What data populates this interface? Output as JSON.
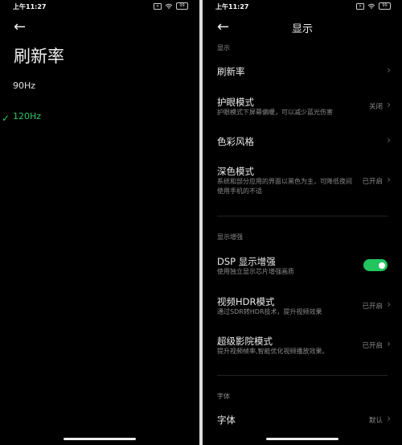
{
  "status_bar": {
    "time": "上午11:27",
    "battery": "99"
  },
  "left": {
    "title": "刷新率",
    "options": [
      {
        "label": "90Hz",
        "selected": false
      },
      {
        "label": "120Hz",
        "selected": true
      }
    ],
    "check_glyph": "✓"
  },
  "right": {
    "title": "显示",
    "sections": [
      {
        "header": "显示"
      },
      {
        "header": "显示增强"
      },
      {
        "header": "字体"
      }
    ],
    "items": [
      {
        "title": "刷新率",
        "subtitle": "",
        "value": ""
      },
      {
        "title": "护眼模式",
        "subtitle": "护眼模式下屏幕偏暖，可以减少蓝光伤害",
        "value": "关闭"
      },
      {
        "title": "色彩风格",
        "subtitle": "",
        "value": ""
      },
      {
        "title": "深色模式",
        "subtitle": "系统和部分应用的界面以黑色为主，可降低夜间使用手机的不适",
        "value": "已开启"
      },
      {
        "title": "DSP 显示增强",
        "subtitle": "使用独立显示芯片增强画质",
        "value": "",
        "toggle_on": true
      },
      {
        "title": "视频HDR模式",
        "subtitle": "通过SDR转HDR技术，提升视频效果",
        "value": "已开启"
      },
      {
        "title": "超级影院模式",
        "subtitle": "提升视频帧率,智能优化视频播放效果。",
        "value": "已开启"
      },
      {
        "title": "字体",
        "subtitle": "",
        "value": "默认"
      }
    ]
  },
  "colors": {
    "accent": "#22c55e",
    "background": "#000000",
    "subtitle": "#8a8a8a"
  },
  "icons": {
    "back": "arrow-left-icon",
    "chevron": "chevron-right-icon",
    "check": "check-icon"
  }
}
